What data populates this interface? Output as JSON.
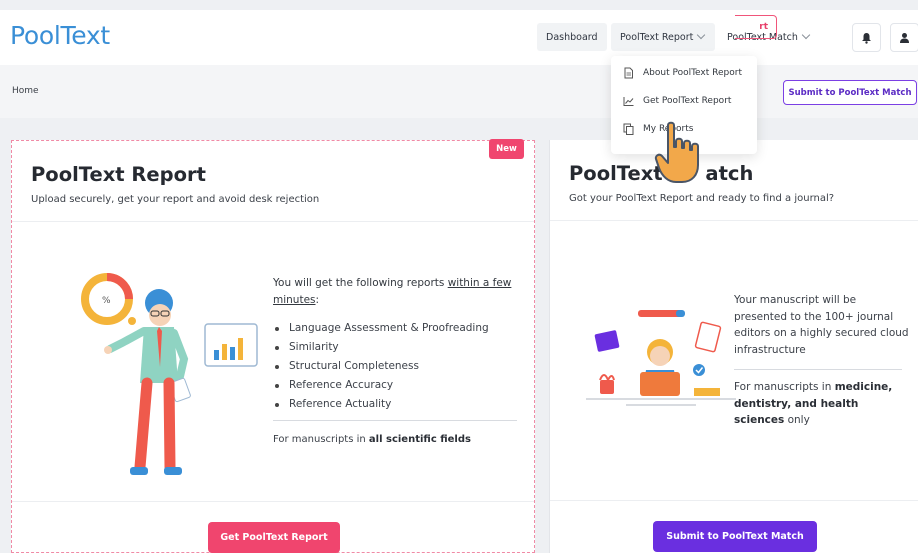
{
  "header": {
    "logo": "PoolText",
    "nav": {
      "dashboard": "Dashboard",
      "report": "PoolText Report",
      "match": "PoolText Match"
    }
  },
  "breadcrumb": {
    "home": "Home"
  },
  "subbar": {
    "partial_button": "rt",
    "submit_button": "Submit to PoolText Match"
  },
  "dropdown": {
    "items": [
      {
        "label": "About PoolText Report",
        "icon": "document-icon"
      },
      {
        "label": "Get PoolText Report",
        "icon": "chart-line-icon"
      },
      {
        "label": "My Reports",
        "icon": "copy-icon"
      }
    ]
  },
  "report_card": {
    "badge": "New",
    "title": "PoolText Report",
    "subtitle": "Upload securely, get your report and avoid desk rejection",
    "intro_pre": "You will get the following reports ",
    "intro_link": "within a few minutes",
    "intro_post": ":",
    "bullets": [
      "Language Assessment & Proofreading",
      "Similarity",
      "Structural Completeness",
      "Reference Accuracy",
      "Reference Actuality"
    ],
    "fields_pre": "For manuscripts in ",
    "fields_bold": "all scientific fields",
    "button": "Get PoolText Report"
  },
  "match_card": {
    "title_a": "PoolText ",
    "title_b": "atch",
    "subtitle": "Got your PoolText Report and ready to find a journal?",
    "text1": "Your manuscript will be presented to the 100+ journal editors on a highly secured cloud infrastructure",
    "text2_pre": "For manuscripts in ",
    "text2_bold": "medicine, dentistry, and health sciences",
    "text2_post": " only",
    "button": "Submit to PoolText Match"
  },
  "colors": {
    "brand": "#3a8fd6",
    "pink": "#f0456e",
    "purple": "#6a2fe0"
  }
}
